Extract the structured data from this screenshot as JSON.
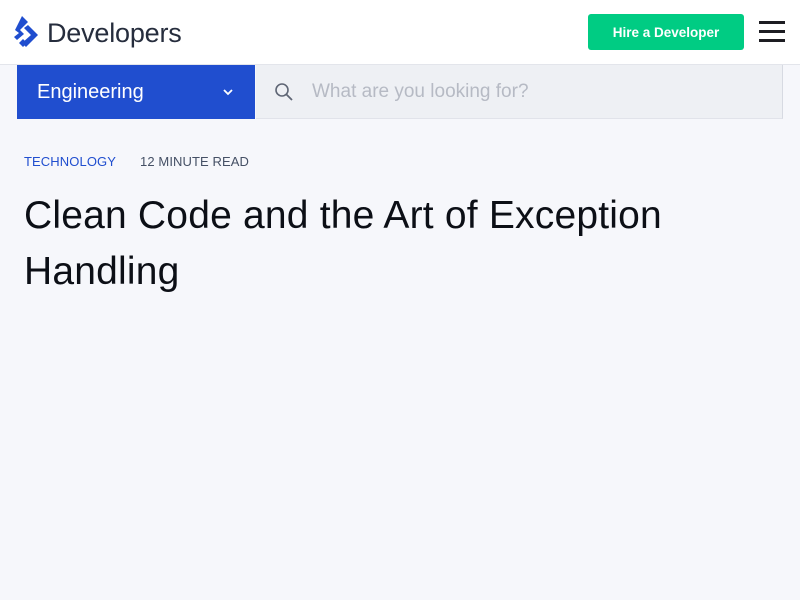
{
  "header": {
    "logo_text": "Developers",
    "hire_button_label": "Hire a Developer",
    "colors": {
      "accent": "#204ecf",
      "cta": "#00cc83"
    }
  },
  "filter": {
    "category": "Engineering",
    "search_placeholder": "What are you looking for?"
  },
  "article": {
    "category": "TECHNOLOGY",
    "read_time": "12 MINUTE READ",
    "title": "Clean Code and the Art of Exception Handling"
  },
  "icons": [
    "logo-icon",
    "chevron-down-icon",
    "search-icon",
    "hamburger-menu-icon"
  ]
}
